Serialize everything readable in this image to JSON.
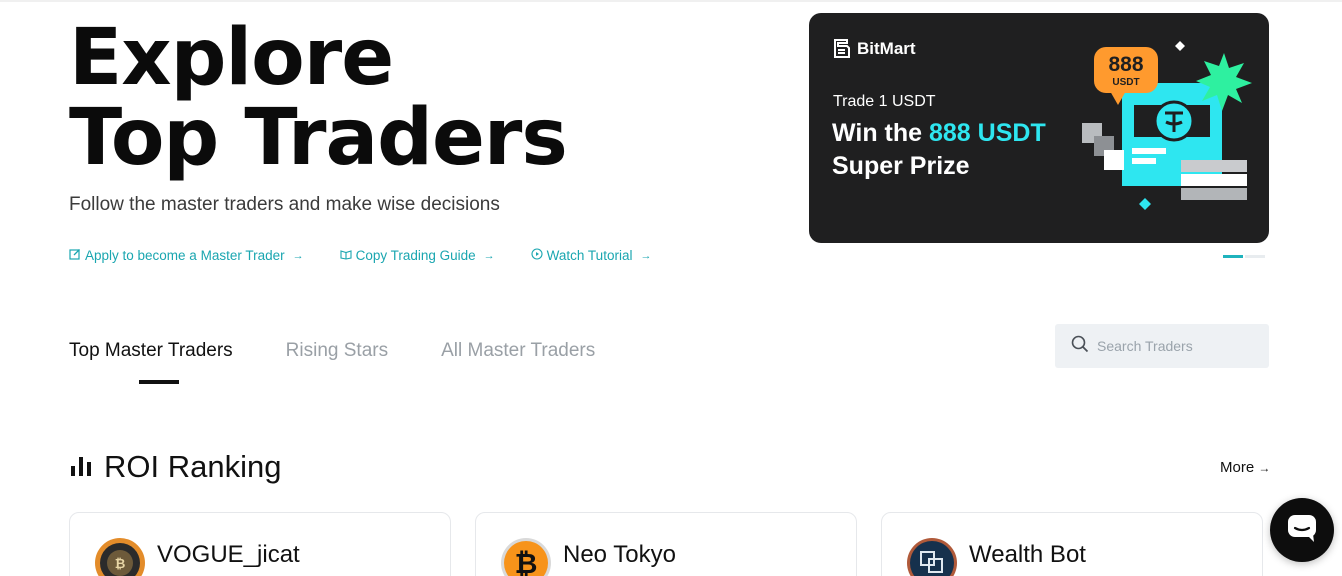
{
  "hero": {
    "title_line1": "Explore",
    "title_line2": "Top Traders",
    "subtitle": "Follow the master traders and make wise decisions"
  },
  "links": [
    {
      "label": "Apply to become a Master Trader",
      "icon": "edit-icon"
    },
    {
      "label": "Copy Trading Guide",
      "icon": "book-icon"
    },
    {
      "label": "Watch Tutorial",
      "icon": "play-circle-icon"
    }
  ],
  "banner": {
    "brand": "BitMart",
    "trade_text": "Trade 1 USDT",
    "win_prefix": "Win the ",
    "win_highlight": "888 USDT",
    "win_suffix": "Super Prize",
    "badge_amount": "888",
    "badge_unit": "USDT",
    "pager": {
      "count": 2,
      "active": 1
    }
  },
  "tabs": [
    {
      "label": "Top Master Traders",
      "active": true
    },
    {
      "label": "Rising Stars",
      "active": false
    },
    {
      "label": "All Master Traders",
      "active": false
    }
  ],
  "search": {
    "placeholder": "Search Traders"
  },
  "roi": {
    "title": "ROI Ranking",
    "more_label": "More"
  },
  "traders": [
    {
      "name": "VOGUE_jicat"
    },
    {
      "name": "Neo Tokyo"
    },
    {
      "name": "Wealth Bot"
    }
  ],
  "colors": {
    "accent": "#1aa6b0",
    "banner_bg": "#1f1f20",
    "highlight": "#2ee6f0"
  }
}
